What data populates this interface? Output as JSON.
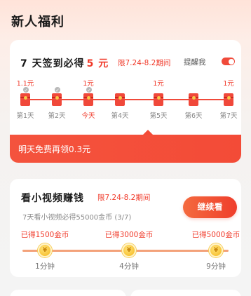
{
  "page": {
    "title": "新人福利"
  },
  "checkin": {
    "title_prefix": "7 天签到必得",
    "title_amount": "5 元",
    "period": "限7.24-8.2期间",
    "remind_label": "提醒我",
    "remind_on": true,
    "days": [
      {
        "label": "第1天",
        "reward": "1.1元",
        "checked": true
      },
      {
        "label": "第2天",
        "reward": "",
        "checked": true
      },
      {
        "label": "今天",
        "reward": "1元",
        "checked": true,
        "today": true
      },
      {
        "label": "第4天",
        "reward": "",
        "checked": false
      },
      {
        "label": "第5天",
        "reward": "1元",
        "checked": false
      },
      {
        "label": "第6天",
        "reward": "",
        "checked": false
      },
      {
        "label": "第7天",
        "reward": "1元",
        "checked": false
      }
    ],
    "tomorrow_text": "明天免费再领0.3元"
  },
  "video": {
    "title": "看小视频赚钱",
    "period": "限7.24-8.2期间",
    "subtitle": "7天看小视频必得55000金币 (3/7)",
    "button_label": "继续看",
    "milestones": [
      {
        "reward": "已得1500金币",
        "time": "1分钟"
      },
      {
        "reward": "已得3000金币",
        "time": "4分钟"
      },
      {
        "reward": "已得5000金币",
        "time": "9分钟"
      }
    ],
    "coin_glyph": "¥"
  },
  "colors": {
    "accent": "#f03a2a",
    "coin": "#f5b81c"
  },
  "icons": {
    "checked": "check-icon",
    "red_packet": "red-packet-icon",
    "coin": "gold-coin-icon"
  }
}
